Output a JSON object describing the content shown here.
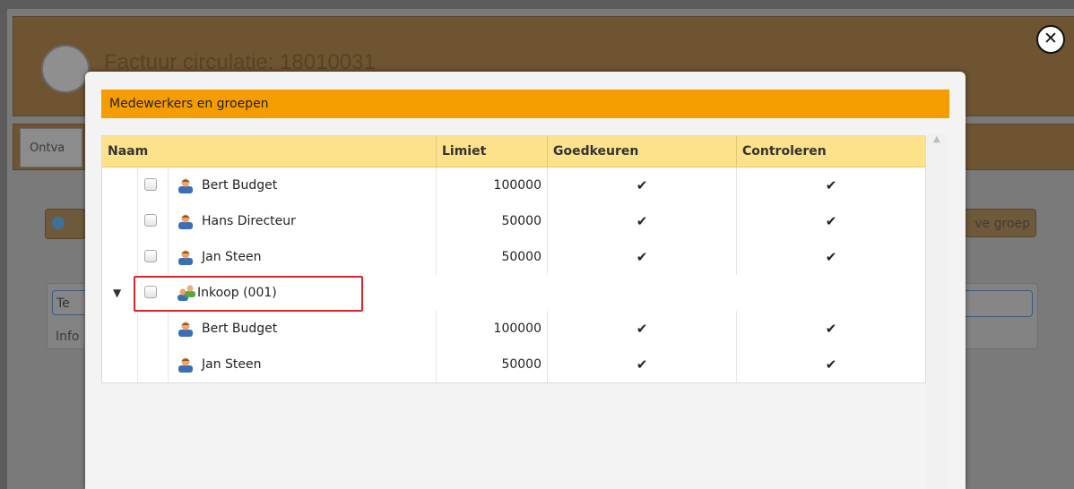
{
  "background": {
    "title": "Factuur circulatie: 18010031",
    "tab_label": "Ontva",
    "group_button_label": "ve groep",
    "field_label": "Te",
    "info_label": "Info"
  },
  "dialog": {
    "title": "Medewerkers en groepen",
    "columns": {
      "name": "Naam",
      "limit": "Limiet",
      "approve": "Goedkeuren",
      "check": "Controleren"
    },
    "rows": [
      {
        "name": "Bert Budget",
        "limit": "100000",
        "approve": "✔",
        "check": "✔"
      },
      {
        "name": "Hans Directeur",
        "limit": "50000",
        "approve": "✔",
        "check": "✔"
      },
      {
        "name": "Jan Steen",
        "limit": "50000",
        "approve": "✔",
        "check": "✔"
      }
    ],
    "group": {
      "name": "Inkoop (001)",
      "members": [
        {
          "name": "Bert Budget",
          "limit": "100000",
          "approve": "✔",
          "check": "✔"
        },
        {
          "name": "Jan Steen",
          "limit": "50000",
          "approve": "✔",
          "check": "✔"
        }
      ]
    }
  },
  "icons": {
    "close": "close-icon",
    "person": "person-icon",
    "group": "group-icon",
    "expand": "expand-arrow-icon"
  },
  "colors": {
    "dialog_header": "#f59c00",
    "grid_header": "#fde28b",
    "highlight": "#d9262a"
  }
}
